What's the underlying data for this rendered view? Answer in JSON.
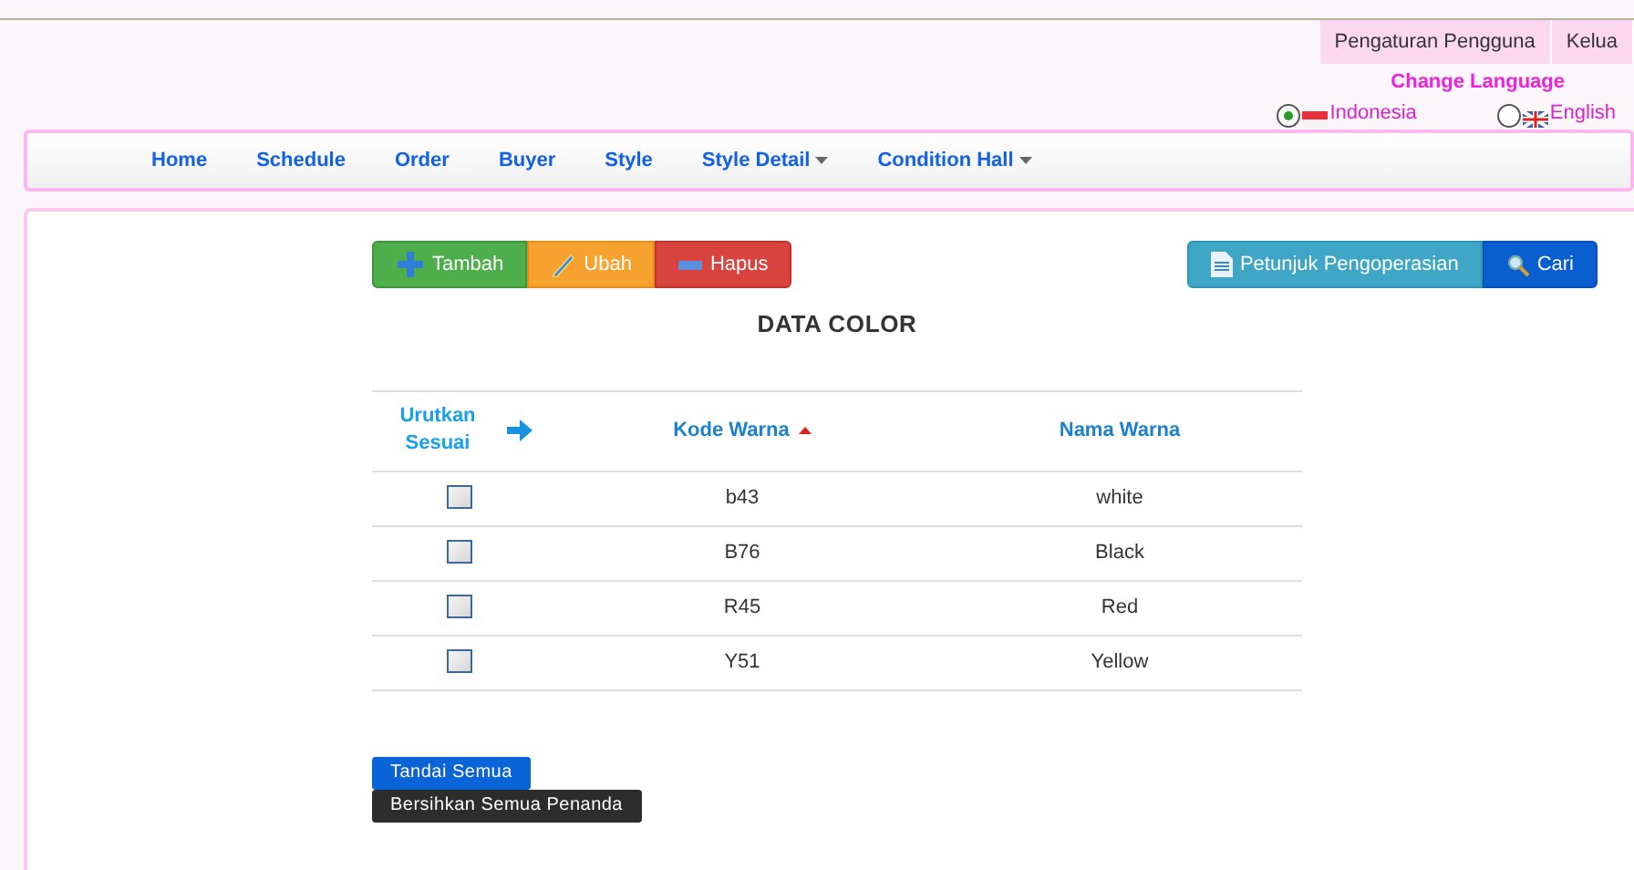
{
  "top_menu": [
    "Pengaturan Pengguna",
    "Kelua"
  ],
  "language": {
    "title": "Change Language",
    "options": [
      {
        "label": "Indonesia",
        "kind": "id",
        "selected": true
      },
      {
        "label": "English",
        "kind": "gb",
        "selected": false
      }
    ]
  },
  "nav": [
    {
      "label": "Home",
      "dropdown": false
    },
    {
      "label": "Schedule",
      "dropdown": false
    },
    {
      "label": "Order",
      "dropdown": false
    },
    {
      "label": "Buyer",
      "dropdown": false
    },
    {
      "label": "Style",
      "dropdown": false
    },
    {
      "label": "Style Detail",
      "dropdown": true
    },
    {
      "label": "Condition Hall",
      "dropdown": true
    }
  ],
  "actions": [
    {
      "label": "Tambah",
      "kind": "add"
    },
    {
      "label": "Ubah",
      "kind": "edit"
    },
    {
      "label": "Hapus",
      "kind": "delete"
    }
  ],
  "help_actions": [
    {
      "label": "Petunjuk Pengoperasian",
      "kind": "help"
    },
    {
      "label": "Cari",
      "kind": "search"
    }
  ],
  "title": "DATA COLOR",
  "table": {
    "columns": [
      {
        "label": "Urutkan Sesuai",
        "sorted": false
      },
      {
        "label": "Kode Warna",
        "sorted": true
      },
      {
        "label": "Nama Warna",
        "sorted": false
      }
    ],
    "rows": [
      {
        "checked": false,
        "code": "b43",
        "name": "white"
      },
      {
        "checked": false,
        "code": "B76",
        "name": "Black"
      },
      {
        "checked": false,
        "code": "R45",
        "name": "Red"
      },
      {
        "checked": false,
        "code": "Y51",
        "name": "Yellow"
      }
    ]
  },
  "bulk_actions": [
    {
      "label": "Tandai Semua",
      "kind": "primary"
    },
    {
      "label": "Bersihkan Semua Penanda",
      "kind": "dark"
    }
  ]
}
